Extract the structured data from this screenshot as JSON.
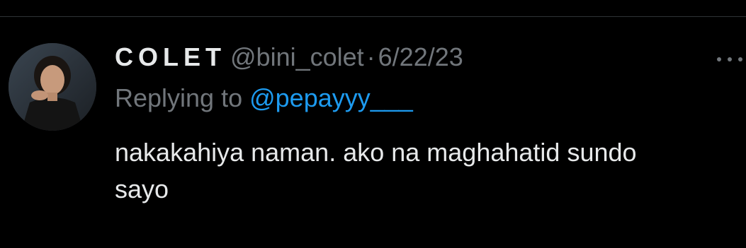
{
  "tweet": {
    "display_name": "COLET",
    "handle": "@bini_colet",
    "separator": "·",
    "timestamp": "6/22/23",
    "reply_prefix": "Replying to",
    "reply_handle": "@pepayyy___",
    "text_lines": [
      "nakakahiya naman. ako na maghahatid sundo",
      "sayo"
    ],
    "more_icon": "more-horizontal-icon",
    "avatar_icon": "profile-photo"
  },
  "colors": {
    "background": "#000000",
    "primary_text": "#e7e9ea",
    "secondary_text": "#71767b",
    "link": "#1d9bf0",
    "divider": "#2f3336"
  }
}
